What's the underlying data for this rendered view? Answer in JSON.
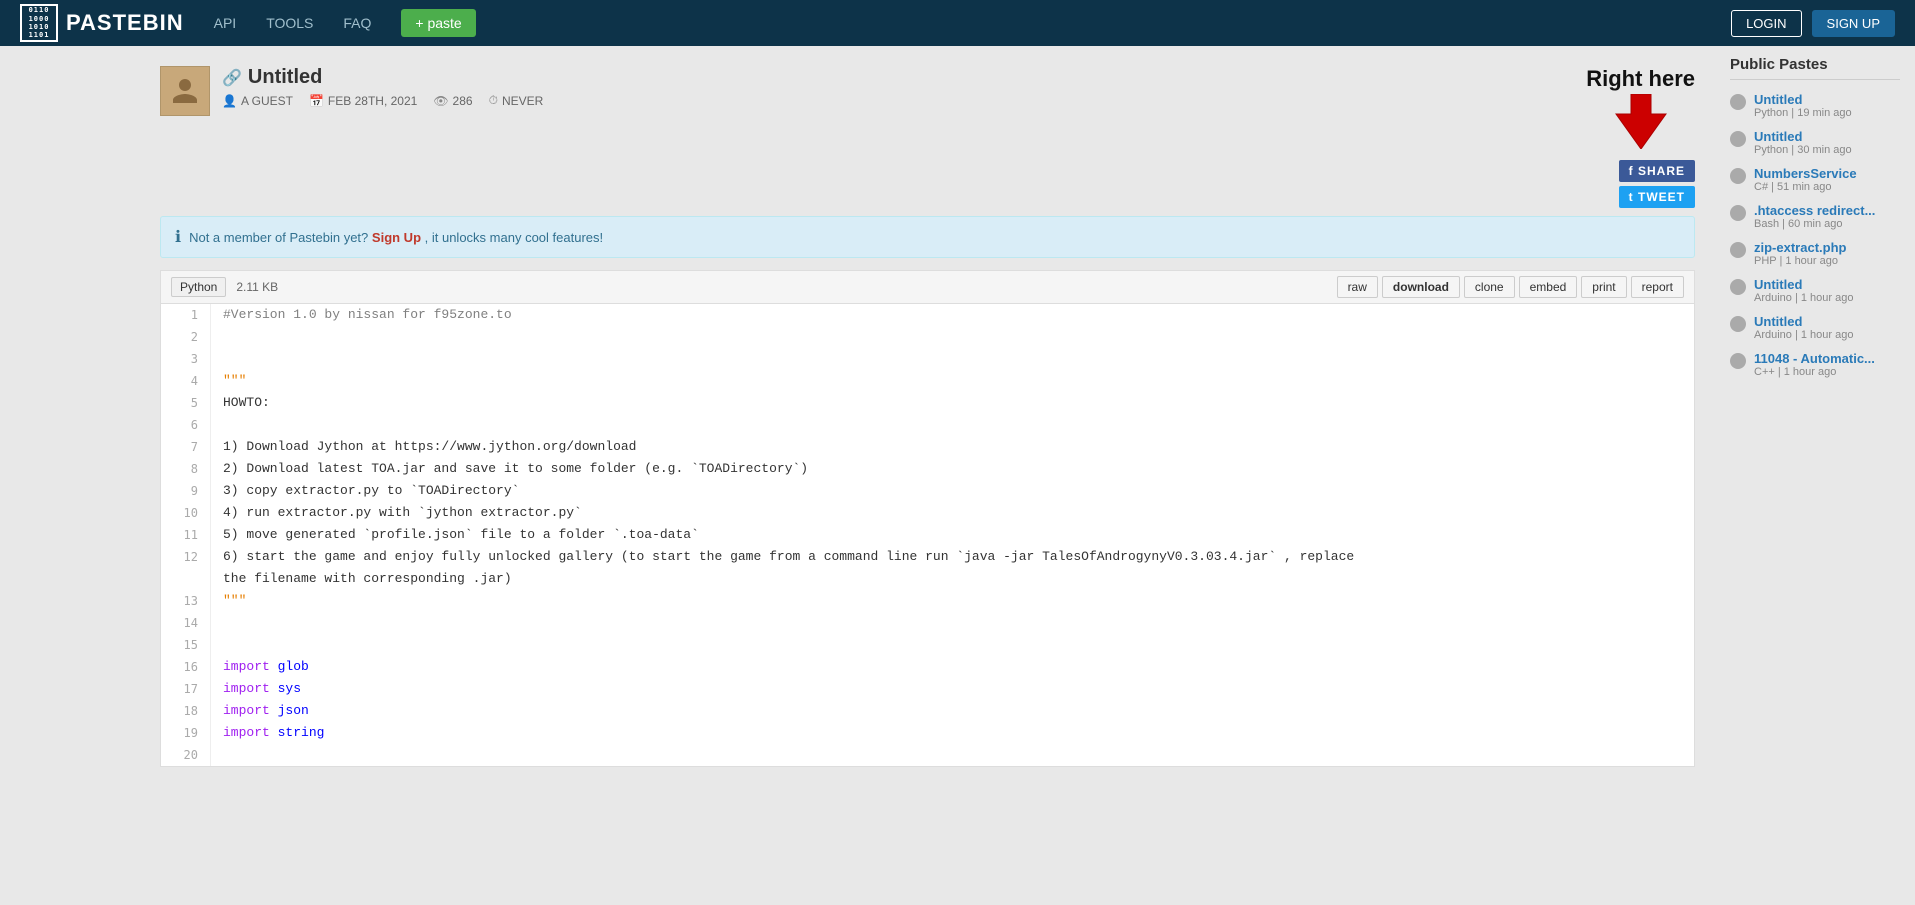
{
  "header": {
    "logo_text": "PASTEBIN",
    "logo_binary": "0110\n1000\n1010\n1101",
    "nav": [
      "API",
      "TOOLS",
      "FAQ"
    ],
    "paste_btn": "+ paste",
    "login_btn": "LOGIN",
    "signup_btn": "SIGN UP"
  },
  "paste": {
    "title": "Untitled",
    "title_icon": "🔗",
    "author": "A GUEST",
    "date": "FEB 28TH, 2021",
    "views": "286",
    "expiry": "NEVER",
    "lang": "Python",
    "size": "2.11 KB",
    "actions": [
      "raw",
      "download",
      "clone",
      "embed",
      "print",
      "report"
    ],
    "annotation_text": "Right here"
  },
  "signup_notice": {
    "text": "Not a member of Pastebin yet?",
    "link_text": "Sign Up",
    "suffix": ", it unlocks many cool features!"
  },
  "share": {
    "fb": "f SHARE",
    "tw": "t TWEET"
  },
  "code": {
    "lines": [
      {
        "num": 1,
        "code": "#Version 1.0 by nissan for f95zone.to",
        "type": "comment"
      },
      {
        "num": 2,
        "code": "",
        "type": "plain"
      },
      {
        "num": 3,
        "code": "",
        "type": "plain"
      },
      {
        "num": 4,
        "code": "\"\"\"",
        "type": "string"
      },
      {
        "num": 5,
        "code": "HOWTO:",
        "type": "plain"
      },
      {
        "num": 6,
        "code": "",
        "type": "plain"
      },
      {
        "num": 7,
        "code": "1) Download Jython at https://www.jython.org/download",
        "type": "plain"
      },
      {
        "num": 8,
        "code": "2) Download latest TOA.jar and save it to some folder (e.g. `TOADirectory`)",
        "type": "plain"
      },
      {
        "num": 9,
        "code": "3) copy extractor.py to `TOADirectory`",
        "type": "plain"
      },
      {
        "num": 10,
        "code": "4) run extractor.py with `jython extractor.py`",
        "type": "plain"
      },
      {
        "num": 11,
        "code": "5) move generated `profile.json` file to a folder `.toa-data`",
        "type": "plain"
      },
      {
        "num": 12,
        "code": "6) start the game and enjoy fully unlocked gallery (to start the game from a command line run `java -jar TalesOfAndrogynyV0.3.03.4.jar` , replace\nthe filename with corresponding .jar)",
        "type": "plain"
      },
      {
        "num": 13,
        "code": "\"\"\"",
        "type": "string"
      },
      {
        "num": 14,
        "code": "",
        "type": "plain"
      },
      {
        "num": 15,
        "code": "",
        "type": "plain"
      },
      {
        "num": 16,
        "code": "import glob",
        "type": "import"
      },
      {
        "num": 17,
        "code": "import sys",
        "type": "import"
      },
      {
        "num": 18,
        "code": "import json",
        "type": "import"
      },
      {
        "num": 19,
        "code": "import string",
        "type": "import"
      },
      {
        "num": 20,
        "code": "",
        "type": "plain"
      }
    ]
  },
  "sidebar": {
    "title": "Public Pastes",
    "items": [
      {
        "name": "Untitled",
        "lang": "Python",
        "time": "19 min ago"
      },
      {
        "name": "Untitled",
        "lang": "Python",
        "time": "30 min ago"
      },
      {
        "name": "NumbersService",
        "lang": "C#",
        "time": "51 min ago"
      },
      {
        "name": ".htaccess redirect...",
        "lang": "Bash",
        "time": "60 min ago"
      },
      {
        "name": "zip-extract.php",
        "lang": "PHP",
        "time": "1 hour ago"
      },
      {
        "name": "Untitled",
        "lang": "Arduino",
        "time": "1 hour ago"
      },
      {
        "name": "Untitled",
        "lang": "Arduino",
        "time": "1 hour ago"
      },
      {
        "name": "11048 - Automatic...",
        "lang": "C++",
        "time": "1 hour ago"
      }
    ]
  }
}
